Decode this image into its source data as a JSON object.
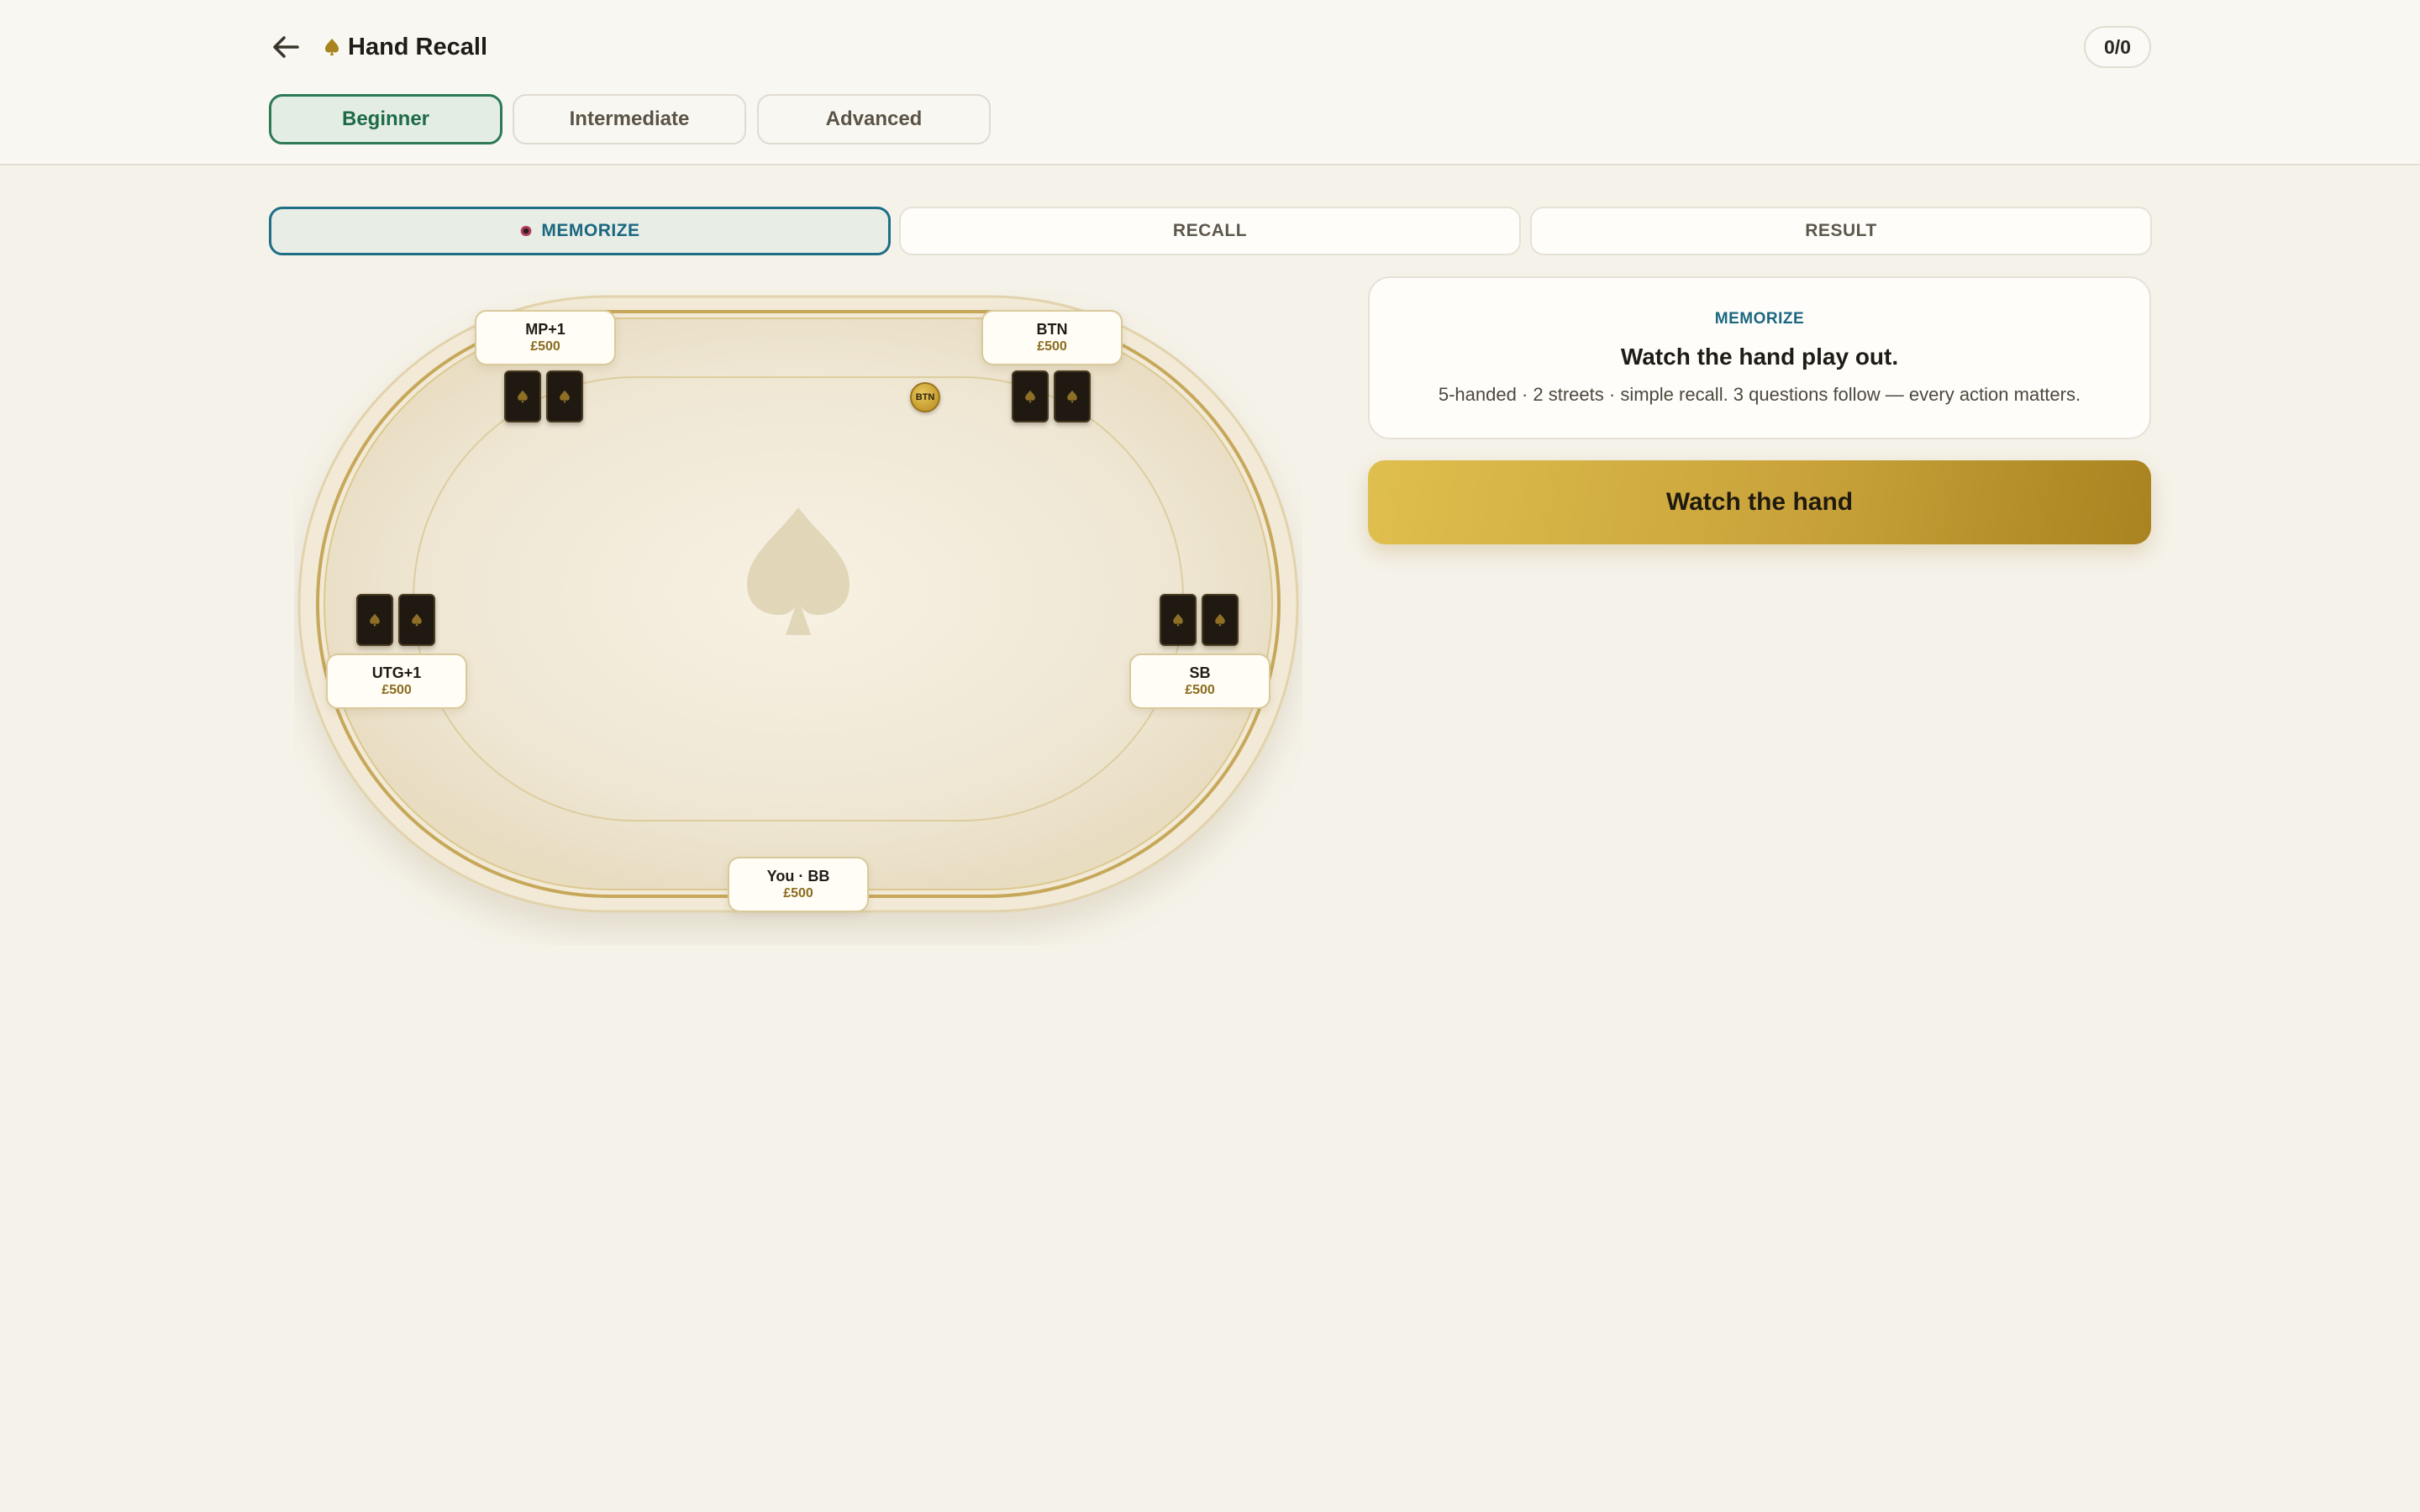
{
  "header": {
    "title": "Hand Recall",
    "counter": "0/0",
    "back_icon": "arrow-left-icon",
    "title_icon": "spade-icon"
  },
  "levels": [
    {
      "label": "Beginner",
      "active": true
    },
    {
      "label": "Intermediate",
      "active": false
    },
    {
      "label": "Advanced",
      "active": false
    }
  ],
  "steps": [
    {
      "label": "MEMORIZE",
      "active": true,
      "icon": "eye-icon"
    },
    {
      "label": "RECALL",
      "active": false
    },
    {
      "label": "RESULT",
      "active": false
    }
  ],
  "table": {
    "center_icon": "spade-icon",
    "dealer_button": "BTN",
    "seats": [
      {
        "name": "MP+1",
        "stack": "£500",
        "cards_face_down": 2
      },
      {
        "name": "BTN",
        "stack": "£500",
        "cards_face_down": 2
      },
      {
        "name": "UTG+1",
        "stack": "£500",
        "cards_face_down": 2
      },
      {
        "name": "SB",
        "stack": "£500",
        "cards_face_down": 2
      },
      {
        "name": "You · BB",
        "stack": "£500",
        "cards_face_down": 0
      }
    ]
  },
  "panel": {
    "label": "MEMORIZE",
    "title": "Watch the hand play out.",
    "description": "5-handed · 2 streets · simple recall. 3 questions follow — every action matters.",
    "button_label": "Watch the hand"
  },
  "colors": {
    "accent_green": "#2e7a55",
    "accent_teal": "#1b6780",
    "gold": "#c9a33a",
    "background": "#f5f2ea"
  }
}
